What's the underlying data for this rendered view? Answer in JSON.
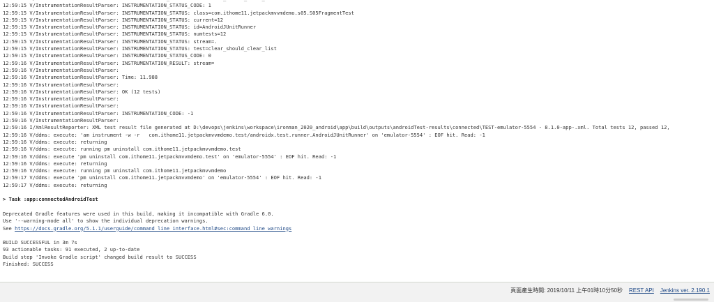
{
  "console": {
    "lines_top": [
      "12:59:15 V/InstrumentationResultParser: INSTRUMENTATION_STATUS: test=clear_should_clear_list",
      "12:59:15 V/InstrumentationResultParser: INSTRUMENTATION_STATUS_CODE: 1",
      "12:59:15 V/InstrumentationResultParser: INSTRUMENTATION_STATUS: class=com.ithome11.jetpackmvvmdemo.s05.S05FragmentTest",
      "12:59:15 V/InstrumentationResultParser: INSTRUMENTATION_STATUS: current=12",
      "12:59:15 V/InstrumentationResultParser: INSTRUMENTATION_STATUS: id=AndroidJUnitRunner",
      "12:59:15 V/InstrumentationResultParser: INSTRUMENTATION_STATUS: numtests=12",
      "12:59:15 V/InstrumentationResultParser: INSTRUMENTATION_STATUS: stream=.",
      "12:59:15 V/InstrumentationResultParser: INSTRUMENTATION_STATUS: test=clear_should_clear_list",
      "12:59:15 V/InstrumentationResultParser: INSTRUMENTATION_STATUS_CODE: 0",
      "12:59:16 V/InstrumentationResultParser: INSTRUMENTATION_RESULT: stream=",
      "12:59:16 V/InstrumentationResultParser:",
      "12:59:16 V/InstrumentationResultParser: Time: 11.988",
      "12:59:16 V/InstrumentationResultParser:",
      "12:59:16 V/InstrumentationResultParser: OK (12 tests)",
      "12:59:16 V/InstrumentationResultParser:",
      "12:59:16 V/InstrumentationResultParser:",
      "12:59:16 V/InstrumentationResultParser: INSTRUMENTATION_CODE: -1",
      "12:59:16 V/InstrumentationResultParser:",
      "12:59:16 I/XmlResultReporter: XML test result file generated at D:\\devops\\jenkins\\workspace\\ironman_2020_android\\app\\build\\outputs\\androidTest-results\\connected\\TEST-emulator-5554 - 8.1.0-app-.xml. Total tests 12, passed 12,",
      "12:59:16 V/ddms: execute: 'am instrument -w -r   com.ithome11.jetpackmvvmdemo.test/androidx.test.runner.AndroidJUnitRunner' on 'emulator-5554' : EOF hit. Read: -1",
      "12:59:16 V/ddms: execute: returning",
      "12:59:16 V/ddms: execute: running pm uninstall com.ithome11.jetpackmvvmdemo.test",
      "12:59:16 V/ddms: execute 'pm uninstall com.ithome11.jetpackmvvmdemo.test' on 'emulator-5554' : EOF hit. Read: -1",
      "12:59:16 V/ddms: execute: returning",
      "12:59:16 V/ddms: execute: running pm uninstall com.ithome11.jetpackmvvmdemo",
      "12:59:17 V/ddms: execute 'pm uninstall com.ithome11.jetpackmvvmdemo' on 'emulator-5554' : EOF hit. Read: -1",
      "12:59:17 V/ddms: execute: returning"
    ],
    "task_line": "> Task :app:connectedAndroidTest",
    "deprecation_1": "Deprecated Gradle features were used in this build, making it incompatible with Gradle 6.0.",
    "deprecation_2": "Use '--warning-mode all' to show the individual deprecation warnings.",
    "see_prefix": "See ",
    "see_link": "https://docs.gradle.org/5.1.1/userguide/command_line_interface.html#sec:command_line_warnings",
    "lines_bottom": [
      "BUILD SUCCESSFUL in 3m 7s",
      "93 actionable tasks: 91 executed, 2 up-to-date",
      "Build step 'Invoke Gradle script' changed build result to SUCCESS",
      "Finished: SUCCESS"
    ]
  },
  "footer": {
    "page_generated": "頁面產生時間: 2019/10/11 上午01時10分50秒",
    "rest_api": "REST API",
    "jenkins_version": "Jenkins ver. 2.190.1"
  }
}
